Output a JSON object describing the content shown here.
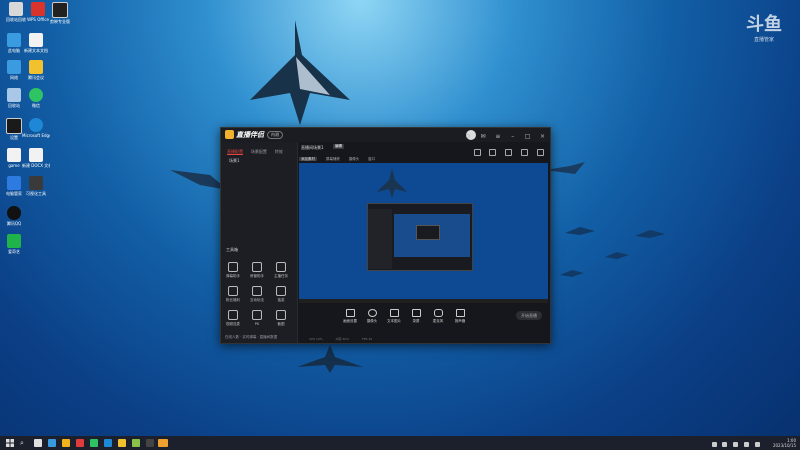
{
  "desktop": {
    "icons": [
      {
        "label": "回收站回收",
        "color": "#d8d8d8"
      },
      {
        "label": "WPS Office",
        "color": "#d9342b"
      },
      {
        "label": "剪映专业版",
        "color": "#222222"
      },
      {
        "label": "此电脑",
        "color": "#3b9be0"
      },
      {
        "label": "新建文本文档",
        "color": "#f2f2f2"
      },
      {
        "label": "网络",
        "color": "#3b9be0"
      },
      {
        "label": "腾讯会议",
        "color": "#f2c12e"
      },
      {
        "label": "回收站",
        "color": "#a9c8e8"
      },
      {
        "label": "微信",
        "color": "#2ec363"
      },
      {
        "label": "设置",
        "color": "#1a1a1a"
      },
      {
        "label": "Microsoft Edge",
        "color": "#1e88d6"
      },
      {
        "label": "game",
        "color": "#f2f2f2"
      },
      {
        "label": "新建 DOCX 文档",
        "color": "#f2f2f2"
      },
      {
        "label": "电脑管家",
        "color": "#2d7be0"
      },
      {
        "label": "可视化工具",
        "color": "#3a3a3a"
      },
      {
        "label": "腾讯QQ",
        "color": "#111111"
      },
      {
        "label": "爱奇艺",
        "color": "#1fb34a"
      }
    ]
  },
  "watermark": {
    "text": "斗鱼",
    "sub": "直播管家"
  },
  "app": {
    "title": "直播伴侣",
    "version": "内测",
    "tabs": [
      "直播配置",
      "场景配置",
      "特效"
    ],
    "scene_label": "场景1",
    "tools_label": "工具箱",
    "tools": [
      "弹幕助手",
      "房管助手",
      "主播任务",
      "粉丝福利",
      "互动玩法",
      "抽奖",
      "视频连麦",
      "PK",
      "截图",
      "点歌台",
      "特效",
      "更多"
    ],
    "bottom_text": "在线人数 · 实时弹幕 · 直播间数据",
    "scene_name": "直播间场景1",
    "scene_tag": "编辑",
    "subbar": [
      "添加素材",
      "屏幕捕获",
      "摄像头",
      "窗口"
    ],
    "controls": [
      "画面设置",
      "摄像头",
      "文本图片",
      "录屏",
      "麦克风",
      "扬声器"
    ],
    "live_button": "开始直播",
    "status": [
      "CPU 12%",
      "内存 40%",
      "FPS 30"
    ]
  },
  "taskbar": {
    "time": "1:00",
    "date": "2023/10/15",
    "items": [
      "#e0e0e0",
      "#3a9ae0",
      "#f2b21c",
      "#e03c3c",
      "#2ec363",
      "#1e88d6",
      "#f2c12e",
      "#8bc34a",
      "#444444",
      "#f0a030"
    ]
  }
}
